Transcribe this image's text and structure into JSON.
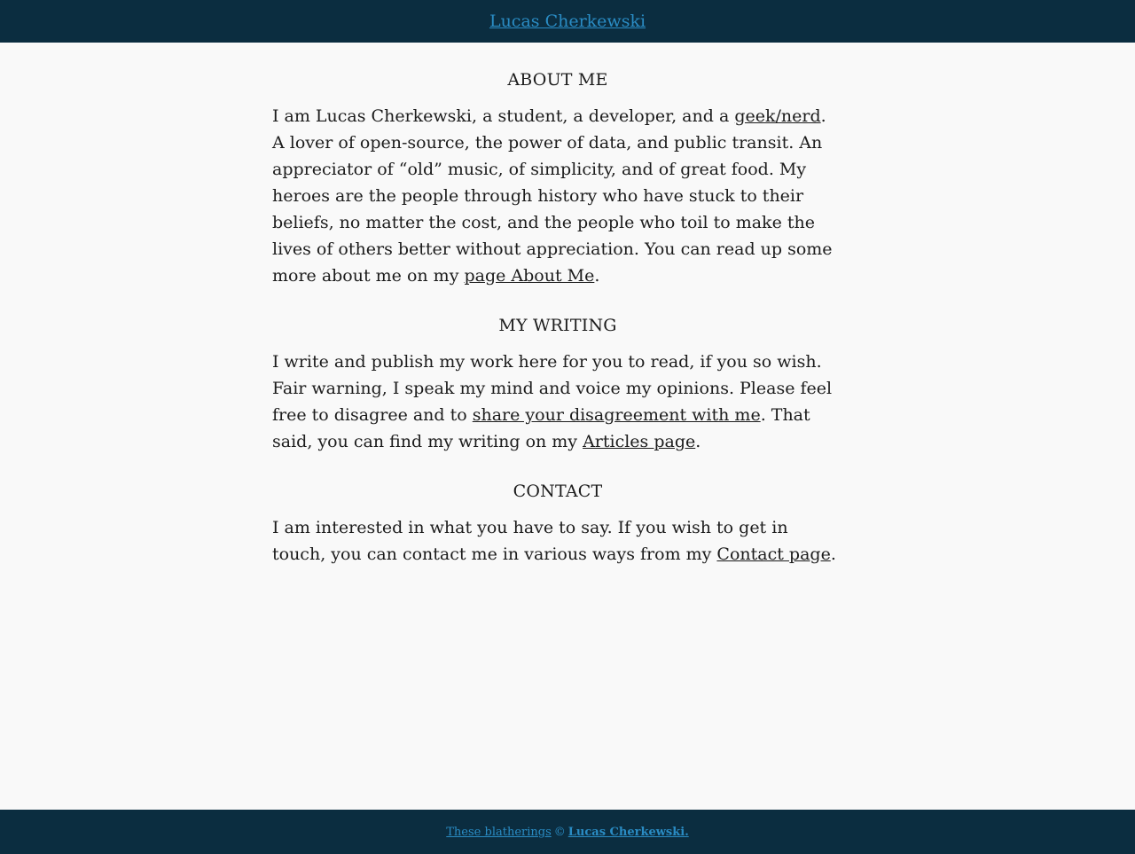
{
  "header": {
    "site_title": "Lucas Cherkewski"
  },
  "sections": {
    "about": {
      "heading": "ABOUT ME",
      "text1": "I am Lucas Cherkewski, a student, a developer, and a ",
      "link1": "geek/nerd",
      "text2": ". A lover of open-source, the power of data, and public transit. An appreciator of “old” music, of simplicity, and of great food. My heroes are the people through history who have stuck to their beliefs, no matter the cost, and the people who toil to make the lives of others better without appreciation. You can read up some more about me on my ",
      "link2": "page About Me",
      "text3": "."
    },
    "writing": {
      "heading": "MY WRITING",
      "text1": "I write and publish my work here for you to read, if you so wish. Fair warning, I speak my mind and voice my opinions. Please feel free to disagree and to ",
      "link1": "share your disagreement with me",
      "text2": ". That said, you can find my writing on my ",
      "link2": "Articles page",
      "text3": "."
    },
    "contact": {
      "heading": "CONTACT",
      "text1": "I am interested in what you have to say. If you wish to get in touch, you can contact me in various ways from my ",
      "link1": "Contact page",
      "text2": "."
    }
  },
  "footer": {
    "prefix": "These blatherings",
    "copyright_symbol": "©",
    "author": "Lucas Cherkewski."
  },
  "colors": {
    "header_bg": "#0b2d40",
    "link_blue": "#2a8cc4",
    "page_bg": "#f9f9f9",
    "text": "#1c1c1c"
  }
}
